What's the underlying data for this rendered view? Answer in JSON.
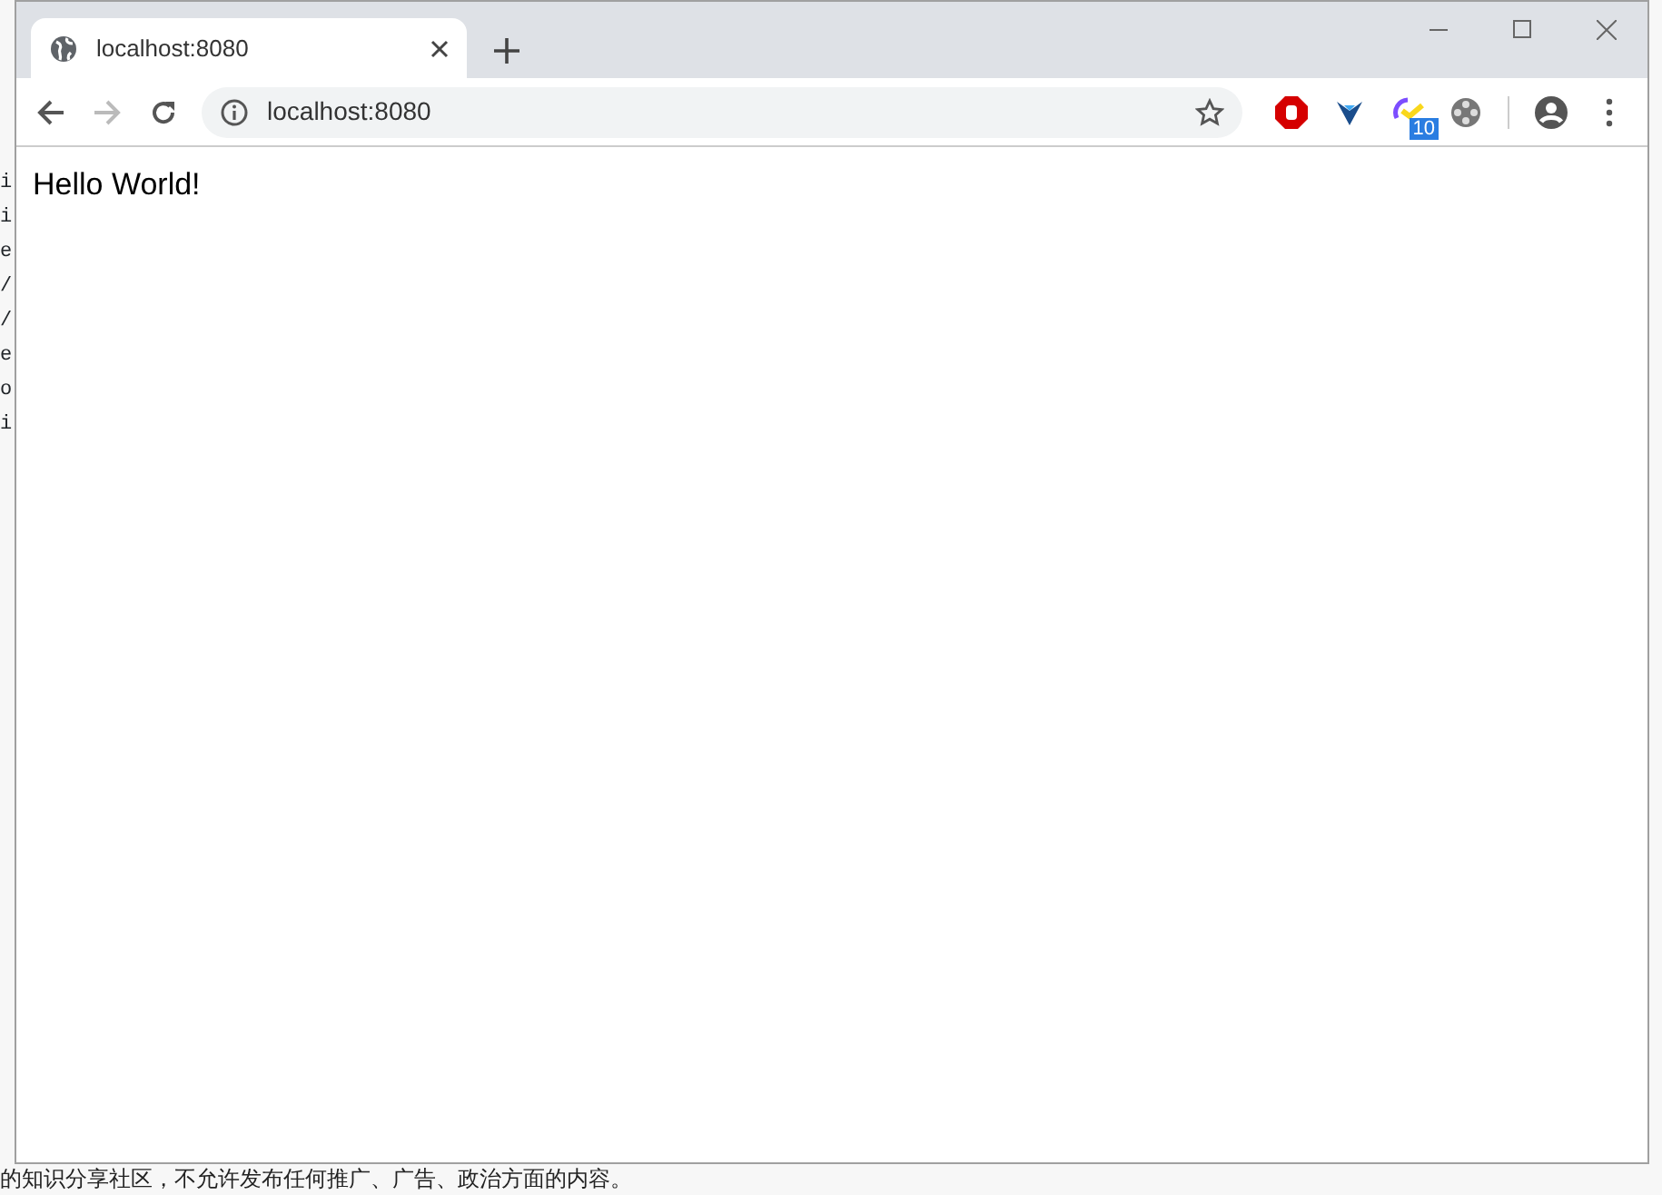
{
  "background": {
    "side_fragments": [
      "i",
      "i",
      "e",
      "/",
      "/",
      "e",
      "o",
      "i"
    ],
    "bottom_line": "的知识分享社区，不允许发布任何推广、广告、政治方面的内容。"
  },
  "browser": {
    "tabs": [
      {
        "title": "localhost:8080",
        "selected": true
      }
    ],
    "address": "localhost:8080",
    "extensions": [
      {
        "kind": "stop"
      },
      {
        "kind": "vee"
      },
      {
        "kind": "calendar",
        "badge": "10"
      },
      {
        "kind": "film"
      }
    ],
    "page": {
      "text": "Hello World!"
    }
  }
}
